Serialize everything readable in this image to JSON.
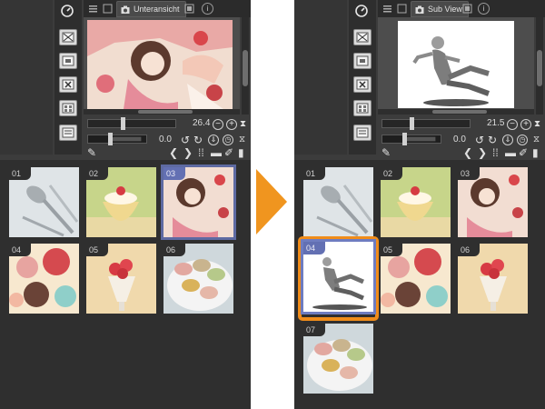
{
  "left_panel": {
    "tab_label": "Unteransicht",
    "zoom_value": "26.4",
    "rotation_value": "0.0",
    "info_glyph": "i",
    "materials": [
      {
        "id": "01",
        "subject": "forks and spoons",
        "selected": false
      },
      {
        "id": "02",
        "subject": "pudding with strawberry",
        "selected": false
      },
      {
        "id": "03",
        "subject": "anime girl illustration",
        "selected": true
      },
      {
        "id": "04",
        "subject": "colored circles",
        "selected": false
      },
      {
        "id": "05",
        "subject": "strawberry parfait",
        "selected": false
      },
      {
        "id": "06",
        "subject": "macarons",
        "selected": false
      }
    ]
  },
  "right_panel": {
    "tab_label": "Sub View",
    "zoom_value": "21.5",
    "rotation_value": "0.0",
    "info_glyph": "i",
    "materials": [
      {
        "id": "01",
        "subject": "forks and spoons",
        "selected": false
      },
      {
        "id": "02",
        "subject": "pudding with strawberry",
        "selected": false
      },
      {
        "id": "03",
        "subject": "anime girl illustration",
        "selected": false
      },
      {
        "id": "04",
        "subject": "3D pose figure",
        "selected": true,
        "highlighted": true
      },
      {
        "id": "05",
        "subject": "colored circles",
        "selected": false
      },
      {
        "id": "06",
        "subject": "strawberry parfait",
        "selected": false
      },
      {
        "id": "07",
        "subject": "macarons",
        "selected": false
      }
    ]
  },
  "colors": {
    "panel_bg": "#3c3c3c",
    "grid_bg": "#2f2f2f",
    "arrow": "#f0951f",
    "highlight": "#f08c1a",
    "selection": "#6370b3"
  },
  "icons": [
    "navigator-icon",
    "camera-icon",
    "info-icon",
    "zoom-in-icon",
    "zoom-out-icon",
    "flip-icon",
    "rotate-icon",
    "eyedropper-icon",
    "prev-icon",
    "next-icon",
    "grid-icon",
    "folder-icon",
    "edit-icon",
    "trash-icon"
  ]
}
